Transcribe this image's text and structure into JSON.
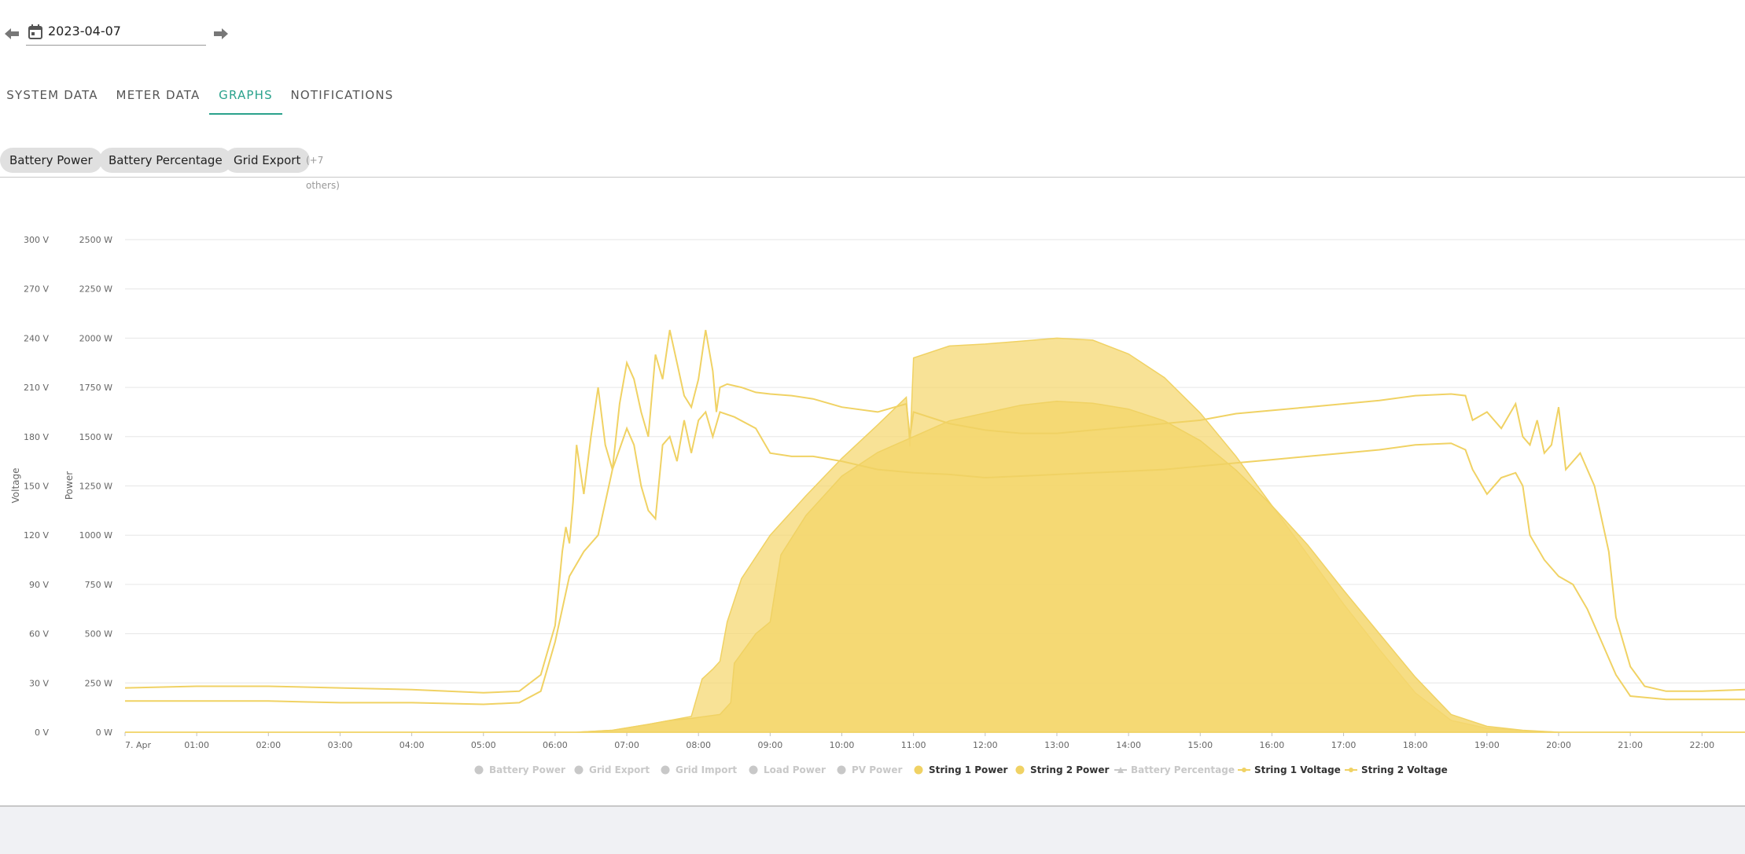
{
  "date_bar": {
    "date_value": "2023-04-07",
    "prev_icon": "arrow-left-icon",
    "next_icon": "arrow-right-icon",
    "calendar_icon": "calendar-icon"
  },
  "tabs": [
    {
      "label": "SYSTEM DATA",
      "active": false
    },
    {
      "label": "METER DATA",
      "active": false
    },
    {
      "label": "GRAPHS",
      "active": true
    },
    {
      "label": "NOTIFICATIONS",
      "active": false
    }
  ],
  "chips": [
    {
      "label": "Battery Power"
    },
    {
      "label": "Battery Percentage"
    },
    {
      "label": "Grid Export"
    }
  ],
  "chips_more": "(+7 others)",
  "colors": {
    "accent": "#2aa28c",
    "series": "#f5d76e",
    "series_line": "#f0d264",
    "inactive_legend": "#c8c8c8"
  },
  "chart_data": {
    "type": "area",
    "y_axes": [
      {
        "label": "Voltage",
        "min": 0,
        "max": 300,
        "ticks": [
          "0 V",
          "30 V",
          "60 V",
          "90 V",
          "120 V",
          "150 V",
          "180 V",
          "210 V",
          "240 V",
          "270 V",
          "300 V"
        ]
      },
      {
        "label": "Power",
        "min": 0,
        "max": 2500,
        "ticks": [
          "0 W",
          "250 W",
          "500 W",
          "750 W",
          "1000 W",
          "1250 W",
          "1500 W",
          "1750 W",
          "2000 W",
          "2250 W",
          "2500 W"
        ]
      }
    ],
    "x_ticks": [
      "7. Apr",
      "01:00",
      "02:00",
      "03:00",
      "04:00",
      "05:00",
      "06:00",
      "07:00",
      "08:00",
      "09:00",
      "10:00",
      "11:00",
      "12:00",
      "13:00",
      "14:00",
      "15:00",
      "16:00",
      "17:00",
      "18:00",
      "19:00",
      "20:00",
      "21:00",
      "22:00"
    ],
    "x_range_hours": [
      0,
      22.6
    ],
    "grid": true,
    "legend_placement": "bottom",
    "legend": [
      {
        "name": "Battery Power",
        "active": false,
        "symbol": "circle"
      },
      {
        "name": "Grid Export",
        "active": false,
        "symbol": "circle"
      },
      {
        "name": "Grid Import",
        "active": false,
        "symbol": "circle"
      },
      {
        "name": "Load Power",
        "active": false,
        "symbol": "circle"
      },
      {
        "name": "PV Power",
        "active": false,
        "symbol": "circle"
      },
      {
        "name": "String 1 Power",
        "active": true,
        "symbol": "circle"
      },
      {
        "name": "String 2 Power",
        "active": true,
        "symbol": "circle"
      },
      {
        "name": "Battery Percentage",
        "active": false,
        "symbol": "triangle-line"
      },
      {
        "name": "String 1 Voltage",
        "active": true,
        "symbol": "line"
      },
      {
        "name": "String 2 Voltage",
        "active": true,
        "symbol": "line"
      }
    ],
    "series": [
      {
        "name": "String 1 Power",
        "type": "area",
        "axis": "power",
        "points": [
          [
            0,
            0
          ],
          [
            6.3,
            0
          ],
          [
            6.8,
            10
          ],
          [
            7.3,
            40
          ],
          [
            7.6,
            60
          ],
          [
            7.9,
            80
          ],
          [
            8.05,
            270
          ],
          [
            8.2,
            320
          ],
          [
            8.3,
            360
          ],
          [
            8.4,
            560
          ],
          [
            8.6,
            780
          ],
          [
            9.0,
            1000
          ],
          [
            9.5,
            1200
          ],
          [
            10.0,
            1390
          ],
          [
            10.5,
            1560
          ],
          [
            10.9,
            1700
          ],
          [
            10.95,
            1450
          ],
          [
            11.0,
            1900
          ],
          [
            11.5,
            1960
          ],
          [
            12.0,
            1970
          ],
          [
            12.5,
            1985
          ],
          [
            13.0,
            2000
          ],
          [
            13.5,
            1990
          ],
          [
            14.0,
            1920
          ],
          [
            14.5,
            1800
          ],
          [
            15.0,
            1620
          ],
          [
            15.5,
            1400
          ],
          [
            16.0,
            1150
          ],
          [
            16.5,
            900
          ],
          [
            17.0,
            650
          ],
          [
            17.5,
            420
          ],
          [
            18.0,
            200
          ],
          [
            18.5,
            60
          ],
          [
            19.0,
            20
          ],
          [
            19.5,
            8
          ],
          [
            20.0,
            0
          ],
          [
            22.6,
            0
          ]
        ]
      },
      {
        "name": "String 2 Power",
        "type": "area",
        "axis": "power",
        "points": [
          [
            0,
            0
          ],
          [
            6.3,
            0
          ],
          [
            6.8,
            10
          ],
          [
            7.3,
            40
          ],
          [
            7.6,
            60
          ],
          [
            7.9,
            70
          ],
          [
            8.3,
            90
          ],
          [
            8.45,
            150
          ],
          [
            8.5,
            350
          ],
          [
            8.8,
            500
          ],
          [
            9.0,
            560
          ],
          [
            9.15,
            900
          ],
          [
            9.5,
            1100
          ],
          [
            10.0,
            1300
          ],
          [
            10.5,
            1420
          ],
          [
            11.0,
            1500
          ],
          [
            11.5,
            1580
          ],
          [
            12.0,
            1620
          ],
          [
            12.5,
            1660
          ],
          [
            13.0,
            1680
          ],
          [
            13.5,
            1670
          ],
          [
            14.0,
            1640
          ],
          [
            14.5,
            1580
          ],
          [
            15.0,
            1480
          ],
          [
            15.5,
            1330
          ],
          [
            16.0,
            1150
          ],
          [
            16.5,
            950
          ],
          [
            17.0,
            720
          ],
          [
            17.5,
            500
          ],
          [
            18.0,
            280
          ],
          [
            18.5,
            90
          ],
          [
            19.0,
            30
          ],
          [
            19.5,
            10
          ],
          [
            20.0,
            0
          ],
          [
            22.6,
            0
          ]
        ]
      },
      {
        "name": "String 1 Voltage",
        "type": "line",
        "axis": "voltage",
        "points": [
          [
            0,
            27
          ],
          [
            1,
            28
          ],
          [
            2,
            28
          ],
          [
            3,
            27
          ],
          [
            4,
            26
          ],
          [
            5,
            24
          ],
          [
            5.5,
            25
          ],
          [
            5.8,
            35
          ],
          [
            6.0,
            65
          ],
          [
            6.1,
            110
          ],
          [
            6.15,
            125
          ],
          [
            6.2,
            115
          ],
          [
            6.25,
            140
          ],
          [
            6.3,
            175
          ],
          [
            6.4,
            145
          ],
          [
            6.5,
            180
          ],
          [
            6.6,
            210
          ],
          [
            6.7,
            175
          ],
          [
            6.8,
            160
          ],
          [
            6.9,
            200
          ],
          [
            7.0,
            225
          ],
          [
            7.1,
            215
          ],
          [
            7.2,
            195
          ],
          [
            7.3,
            180
          ],
          [
            7.4,
            230
          ],
          [
            7.5,
            215
          ],
          [
            7.6,
            245
          ],
          [
            7.7,
            225
          ],
          [
            7.8,
            205
          ],
          [
            7.9,
            198
          ],
          [
            8.0,
            215
          ],
          [
            8.1,
            245
          ],
          [
            8.2,
            220
          ],
          [
            8.25,
            195
          ],
          [
            8.3,
            210
          ],
          [
            8.4,
            212
          ],
          [
            8.6,
            210
          ],
          [
            8.8,
            207
          ],
          [
            9.0,
            206
          ],
          [
            9.3,
            205
          ],
          [
            9.6,
            203
          ],
          [
            10.0,
            198
          ],
          [
            10.5,
            195
          ],
          [
            10.9,
            200
          ],
          [
            10.95,
            180
          ],
          [
            11.0,
            195
          ],
          [
            11.5,
            188
          ],
          [
            12.0,
            184
          ],
          [
            12.5,
            182
          ],
          [
            13.0,
            182
          ],
          [
            13.5,
            184
          ],
          [
            14.0,
            186
          ],
          [
            14.5,
            188
          ],
          [
            15.0,
            190
          ],
          [
            15.5,
            194
          ],
          [
            16.0,
            196
          ],
          [
            16.5,
            198
          ],
          [
            17.0,
            200
          ],
          [
            17.5,
            202
          ],
          [
            18.0,
            205
          ],
          [
            18.5,
            206
          ],
          [
            18.7,
            205
          ],
          [
            18.8,
            190
          ],
          [
            19.0,
            195
          ],
          [
            19.2,
            185
          ],
          [
            19.4,
            200
          ],
          [
            19.5,
            180
          ],
          [
            19.6,
            175
          ],
          [
            19.7,
            190
          ],
          [
            19.8,
            170
          ],
          [
            19.9,
            175
          ],
          [
            20.0,
            198
          ],
          [
            20.1,
            160
          ],
          [
            20.3,
            170
          ],
          [
            20.5,
            150
          ],
          [
            20.7,
            110
          ],
          [
            20.8,
            70
          ],
          [
            21.0,
            40
          ],
          [
            21.2,
            28
          ],
          [
            21.5,
            25
          ],
          [
            22.0,
            25
          ],
          [
            22.6,
            26
          ]
        ]
      },
      {
        "name": "String 2 Voltage",
        "type": "line",
        "axis": "voltage",
        "points": [
          [
            0,
            19
          ],
          [
            1,
            19
          ],
          [
            2,
            19
          ],
          [
            3,
            18
          ],
          [
            4,
            18
          ],
          [
            5,
            17
          ],
          [
            5.5,
            18
          ],
          [
            5.8,
            25
          ],
          [
            6.0,
            55
          ],
          [
            6.2,
            95
          ],
          [
            6.4,
            110
          ],
          [
            6.6,
            120
          ],
          [
            6.8,
            160
          ],
          [
            7.0,
            185
          ],
          [
            7.1,
            175
          ],
          [
            7.2,
            150
          ],
          [
            7.3,
            135
          ],
          [
            7.4,
            130
          ],
          [
            7.5,
            175
          ],
          [
            7.6,
            180
          ],
          [
            7.7,
            165
          ],
          [
            7.8,
            190
          ],
          [
            7.9,
            170
          ],
          [
            8.0,
            190
          ],
          [
            8.1,
            195
          ],
          [
            8.2,
            180
          ],
          [
            8.3,
            195
          ],
          [
            8.5,
            192
          ],
          [
            8.8,
            185
          ],
          [
            9.0,
            170
          ],
          [
            9.3,
            168
          ],
          [
            9.6,
            168
          ],
          [
            10.0,
            165
          ],
          [
            10.5,
            160
          ],
          [
            11.0,
            158
          ],
          [
            11.5,
            157
          ],
          [
            12.0,
            155
          ],
          [
            12.5,
            156
          ],
          [
            13.0,
            157
          ],
          [
            13.5,
            158
          ],
          [
            14.0,
            159
          ],
          [
            14.5,
            160
          ],
          [
            15.0,
            162
          ],
          [
            15.5,
            164
          ],
          [
            16.0,
            166
          ],
          [
            16.5,
            168
          ],
          [
            17.0,
            170
          ],
          [
            17.5,
            172
          ],
          [
            18.0,
            175
          ],
          [
            18.5,
            176
          ],
          [
            18.7,
            172
          ],
          [
            18.8,
            160
          ],
          [
            19.0,
            145
          ],
          [
            19.2,
            155
          ],
          [
            19.4,
            158
          ],
          [
            19.5,
            150
          ],
          [
            19.6,
            120
          ],
          [
            19.8,
            105
          ],
          [
            20.0,
            95
          ],
          [
            20.2,
            90
          ],
          [
            20.4,
            75
          ],
          [
            20.6,
            55
          ],
          [
            20.8,
            35
          ],
          [
            21.0,
            22
          ],
          [
            21.5,
            20
          ],
          [
            22.0,
            20
          ],
          [
            22.6,
            20
          ]
        ]
      }
    ]
  }
}
